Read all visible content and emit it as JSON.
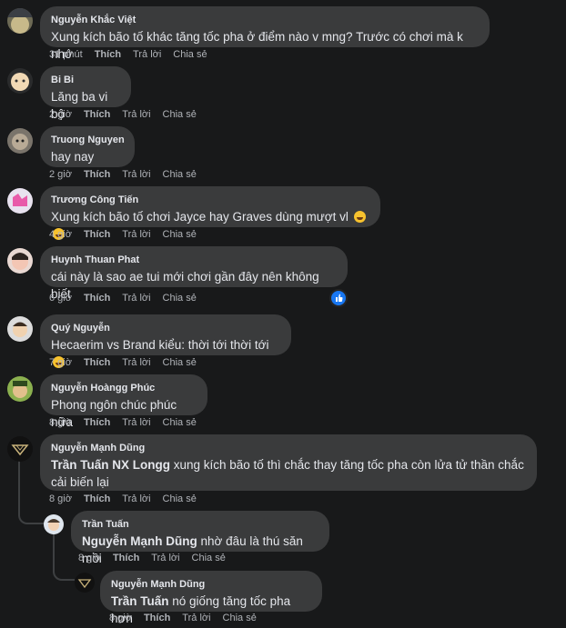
{
  "comments": [
    {
      "author": "Nguyễn Khắc Việt",
      "text": "Xung kích bão tố khác tăng tốc pha ở điểm nào v mng? Trước có chơi mà k nhớ",
      "time": "31 phút",
      "like": "Thích",
      "reply": "Trả lời",
      "share": "Chia sẻ"
    },
    {
      "author": "Bi Bi",
      "text": "Lăng ba vi bộ",
      "time": "2 giờ",
      "like": "Thích",
      "reply": "Trả lời",
      "share": "Chia sẻ"
    },
    {
      "author": "Truong Nguyen",
      "text": "hay nay",
      "time": "2 giờ",
      "like": "Thích",
      "reply": "Trả lời",
      "share": "Chia sẻ"
    },
    {
      "author": "Trương Công Tiến",
      "text": "Xung kích bão tố chơi Jayce hay Graves dùng mượt vl",
      "emoji": "rofl-emoji",
      "time": "4 giờ",
      "like": "Thích",
      "reply": "Trả lời",
      "share": "Chia sẻ"
    },
    {
      "author": "Huynh Thuan Phat",
      "text": "cái này là sao ae tui mới chơi gần đây nên không biết",
      "time": "6 giờ",
      "like": "Thích",
      "reply": "Trả lời",
      "share": "Chia sẻ",
      "reaction": "like-icon"
    },
    {
      "author": "Quý Nguyễn",
      "text": "Hecaerim vs Brand kiểu: thời tới thời tới",
      "emoji": "grin-emoji",
      "time": "7 giờ",
      "like": "Thích",
      "reply": "Trả lời",
      "share": "Chia sẻ"
    },
    {
      "author": "Nguyễn Hoàngg Phúc",
      "text": "Phong ngôn chúc phúc nữa",
      "time": "8 giờ",
      "like": "Thích",
      "reply": "Trả lời",
      "share": "Chia sẻ"
    },
    {
      "author": "Nguyễn Mạnh Dũng",
      "mention": "Trần Tuấn NX Longg",
      "text": " xung kích bão tố thì chắc thay tăng tốc pha còn lửa tử thần chắc cải biến lại",
      "time": "8 giờ",
      "like": "Thích",
      "reply": "Trả lời",
      "share": "Chia sẻ"
    },
    {
      "author": "Trần Tuấn",
      "mention": "Nguyễn Mạnh Dũng",
      "text": " nhờ đâu là thú săn mồi",
      "time": "8 giờ",
      "like": "Thích",
      "reply": "Trả lời",
      "share": "Chia sẻ"
    },
    {
      "author": "Nguyễn Mạnh Dũng",
      "mention": "Trần Tuấn",
      "text": " nó giống tăng tốc pha hơn",
      "time": "8 giờ",
      "like": "Thích",
      "reply": "Trả lời",
      "share": "Chia sẻ"
    }
  ],
  "colors": {
    "background": "#18191a",
    "bubble": "#3a3b3c",
    "meta": "#b0b3b8",
    "accent": "#1877f2"
  }
}
